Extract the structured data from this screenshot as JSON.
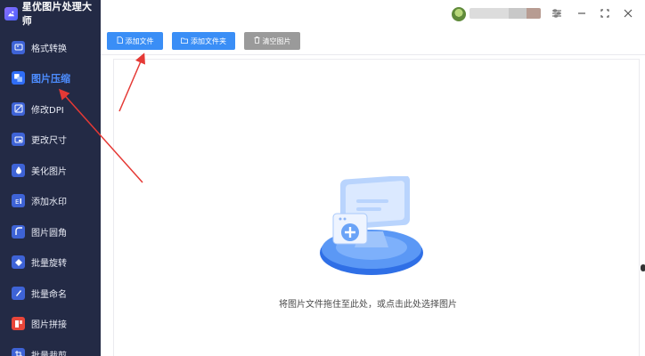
{
  "app": {
    "title": "星优图片处理大师"
  },
  "sidebar": {
    "items": [
      {
        "label": "格式转换",
        "icon": "format-convert-icon"
      },
      {
        "label": "图片压缩",
        "icon": "image-compress-icon",
        "active": true
      },
      {
        "label": "修改DPI",
        "icon": "dpi-icon"
      },
      {
        "label": "更改尺寸",
        "icon": "resize-icon"
      },
      {
        "label": "美化图片",
        "icon": "beautify-icon"
      },
      {
        "label": "添加水印",
        "icon": "watermark-icon"
      },
      {
        "label": "图片圆角",
        "icon": "rounded-corner-icon"
      },
      {
        "label": "批量旋转",
        "icon": "rotate-icon"
      },
      {
        "label": "批量命名",
        "icon": "rename-icon"
      },
      {
        "label": "图片拼接",
        "icon": "stitch-icon"
      },
      {
        "label": "批量裁剪",
        "icon": "crop-icon"
      }
    ]
  },
  "toolbar": {
    "add_file": "添加文件",
    "add_folder": "添加文件夹",
    "clear": "清空图片"
  },
  "main": {
    "drop_hint": "将图片文件拖住至此处，或点击此处选择图片"
  },
  "colors": {
    "sidebar_bg": "#232a45",
    "accent": "#3a8ef6",
    "annotation_arrow": "#e53935"
  }
}
